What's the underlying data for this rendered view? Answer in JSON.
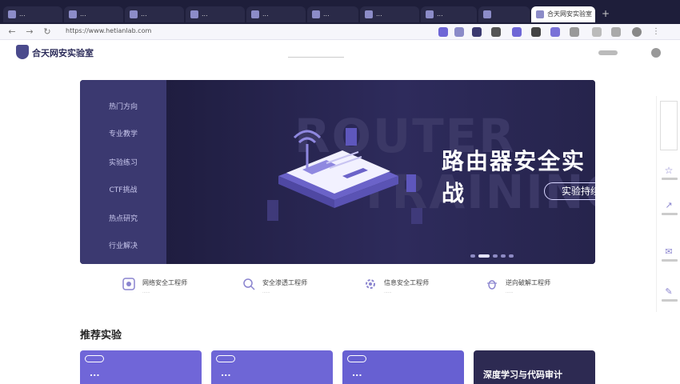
{
  "browser": {
    "tabs": [
      {
        "label": "..."
      },
      {
        "label": "..."
      },
      {
        "label": "..."
      },
      {
        "label": "..."
      },
      {
        "label": "..."
      },
      {
        "label": "..."
      },
      {
        "label": "..."
      },
      {
        "label": "..."
      },
      {
        "label": "合天网安实验室"
      }
    ],
    "url": "https://www.hetianlab.com"
  },
  "site": {
    "brand": "合天网安实验室"
  },
  "banner": {
    "menu": [
      "热门方向",
      "专业教学",
      "实验练习",
      "CTF挑战",
      "热点研究",
      "行业解决"
    ],
    "bg_words": [
      "ROUTER",
      "TRAINING"
    ],
    "title": "路由器安全实战",
    "button": "实验持续更新"
  },
  "features": [
    {
      "title": "网络安全工程师",
      "sub": "......"
    },
    {
      "title": "安全渗透工程师",
      "sub": "......"
    },
    {
      "title": "信息安全工程师",
      "sub": "......"
    },
    {
      "title": "逆向破解工程师",
      "sub": "......"
    }
  ],
  "recommend": {
    "title": "推荐实验",
    "cards": [
      {
        "title": "...",
        "color": "#7066d8"
      },
      {
        "title": "...",
        "color": "#6e66d6"
      },
      {
        "title": "...",
        "color": "#6760d2"
      },
      {
        "title": "深度学习与代码审计",
        "color": "#2d2a52"
      }
    ]
  },
  "colors": {
    "brand": "#4a4a8c",
    "banner_bg": "#23214a",
    "menu_bg": "#3b3970",
    "card_accent": "#6e66d6"
  }
}
